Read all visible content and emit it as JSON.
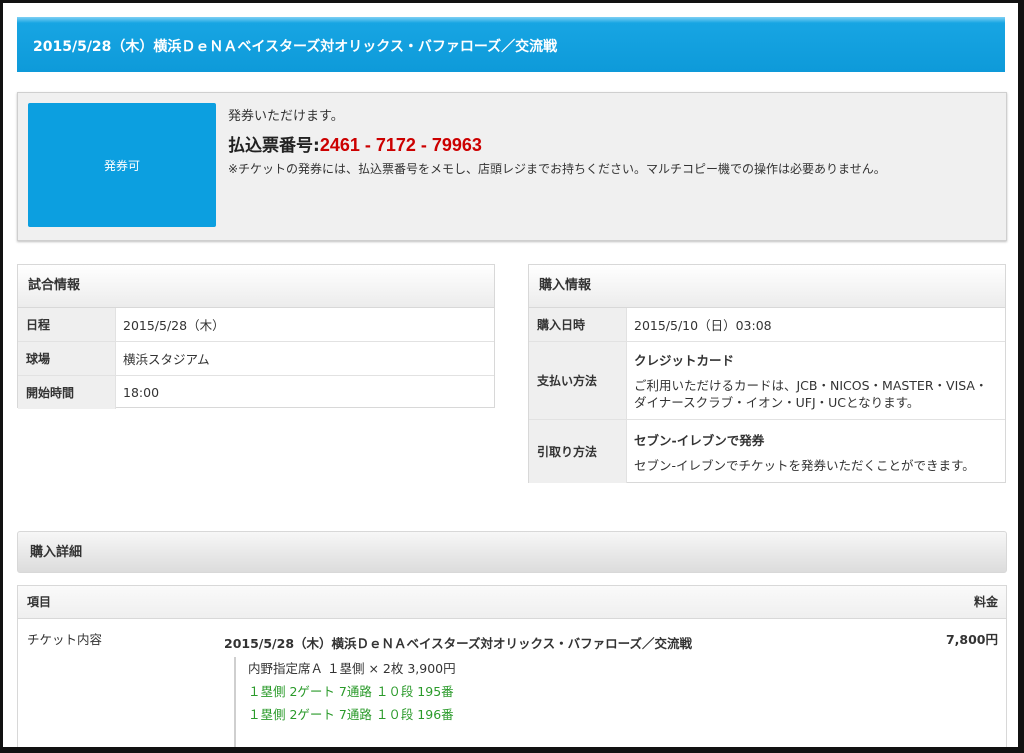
{
  "header": {
    "title": "2015/5/28（木）横浜ＤｅＮＡベイスターズ対オリックス・バファローズ／交流戦"
  },
  "status": {
    "badge": "発券可",
    "message": "発券いただけます。",
    "code_label": "払込票番号:",
    "code": "2461 - 7172 - 79963",
    "note": "※チケットの発券には、払込票番号をメモし、店頭レジまでお持ちください。マルチコピー機での操作は必要ありません。"
  },
  "game_info": {
    "heading": "試合情報",
    "rows": [
      {
        "label": "日程",
        "value": "2015/5/28（木）"
      },
      {
        "label": "球場",
        "value": "横浜スタジアム"
      },
      {
        "label": "開始時間",
        "value": "18:00"
      }
    ]
  },
  "purchase_info": {
    "heading": "購入情報",
    "date_label": "購入日時",
    "date_value": "2015/5/10（日）03:08",
    "payment_label": "支払い方法",
    "payment_title": "クレジットカード",
    "payment_desc": "ご利用いただけるカードは、JCB・NICOS・MASTER・VISA・ダイナースクラブ・イオン・UFJ・UCとなります。",
    "pickup_label": "引取り方法",
    "pickup_title": "セブン-イレブンで発券",
    "pickup_desc": "セブン-イレブンでチケットを発券いただくことができます。"
  },
  "details": {
    "heading": "購入詳細",
    "col_item": "項目",
    "col_price": "料金",
    "row_label": "チケット内容",
    "event_name": "2015/5/28（木）横浜ＤｅＮＡベイスターズ対オリックス・バファローズ／交流戦",
    "price": "7,800円",
    "seat_type": "内野指定席Ａ １塁側 × 2枚 3,900円",
    "seats": [
      "１塁側 2ゲート 7通路 １０段 195番",
      "１塁側 2ゲート 7通路 １０段 196番"
    ]
  }
}
